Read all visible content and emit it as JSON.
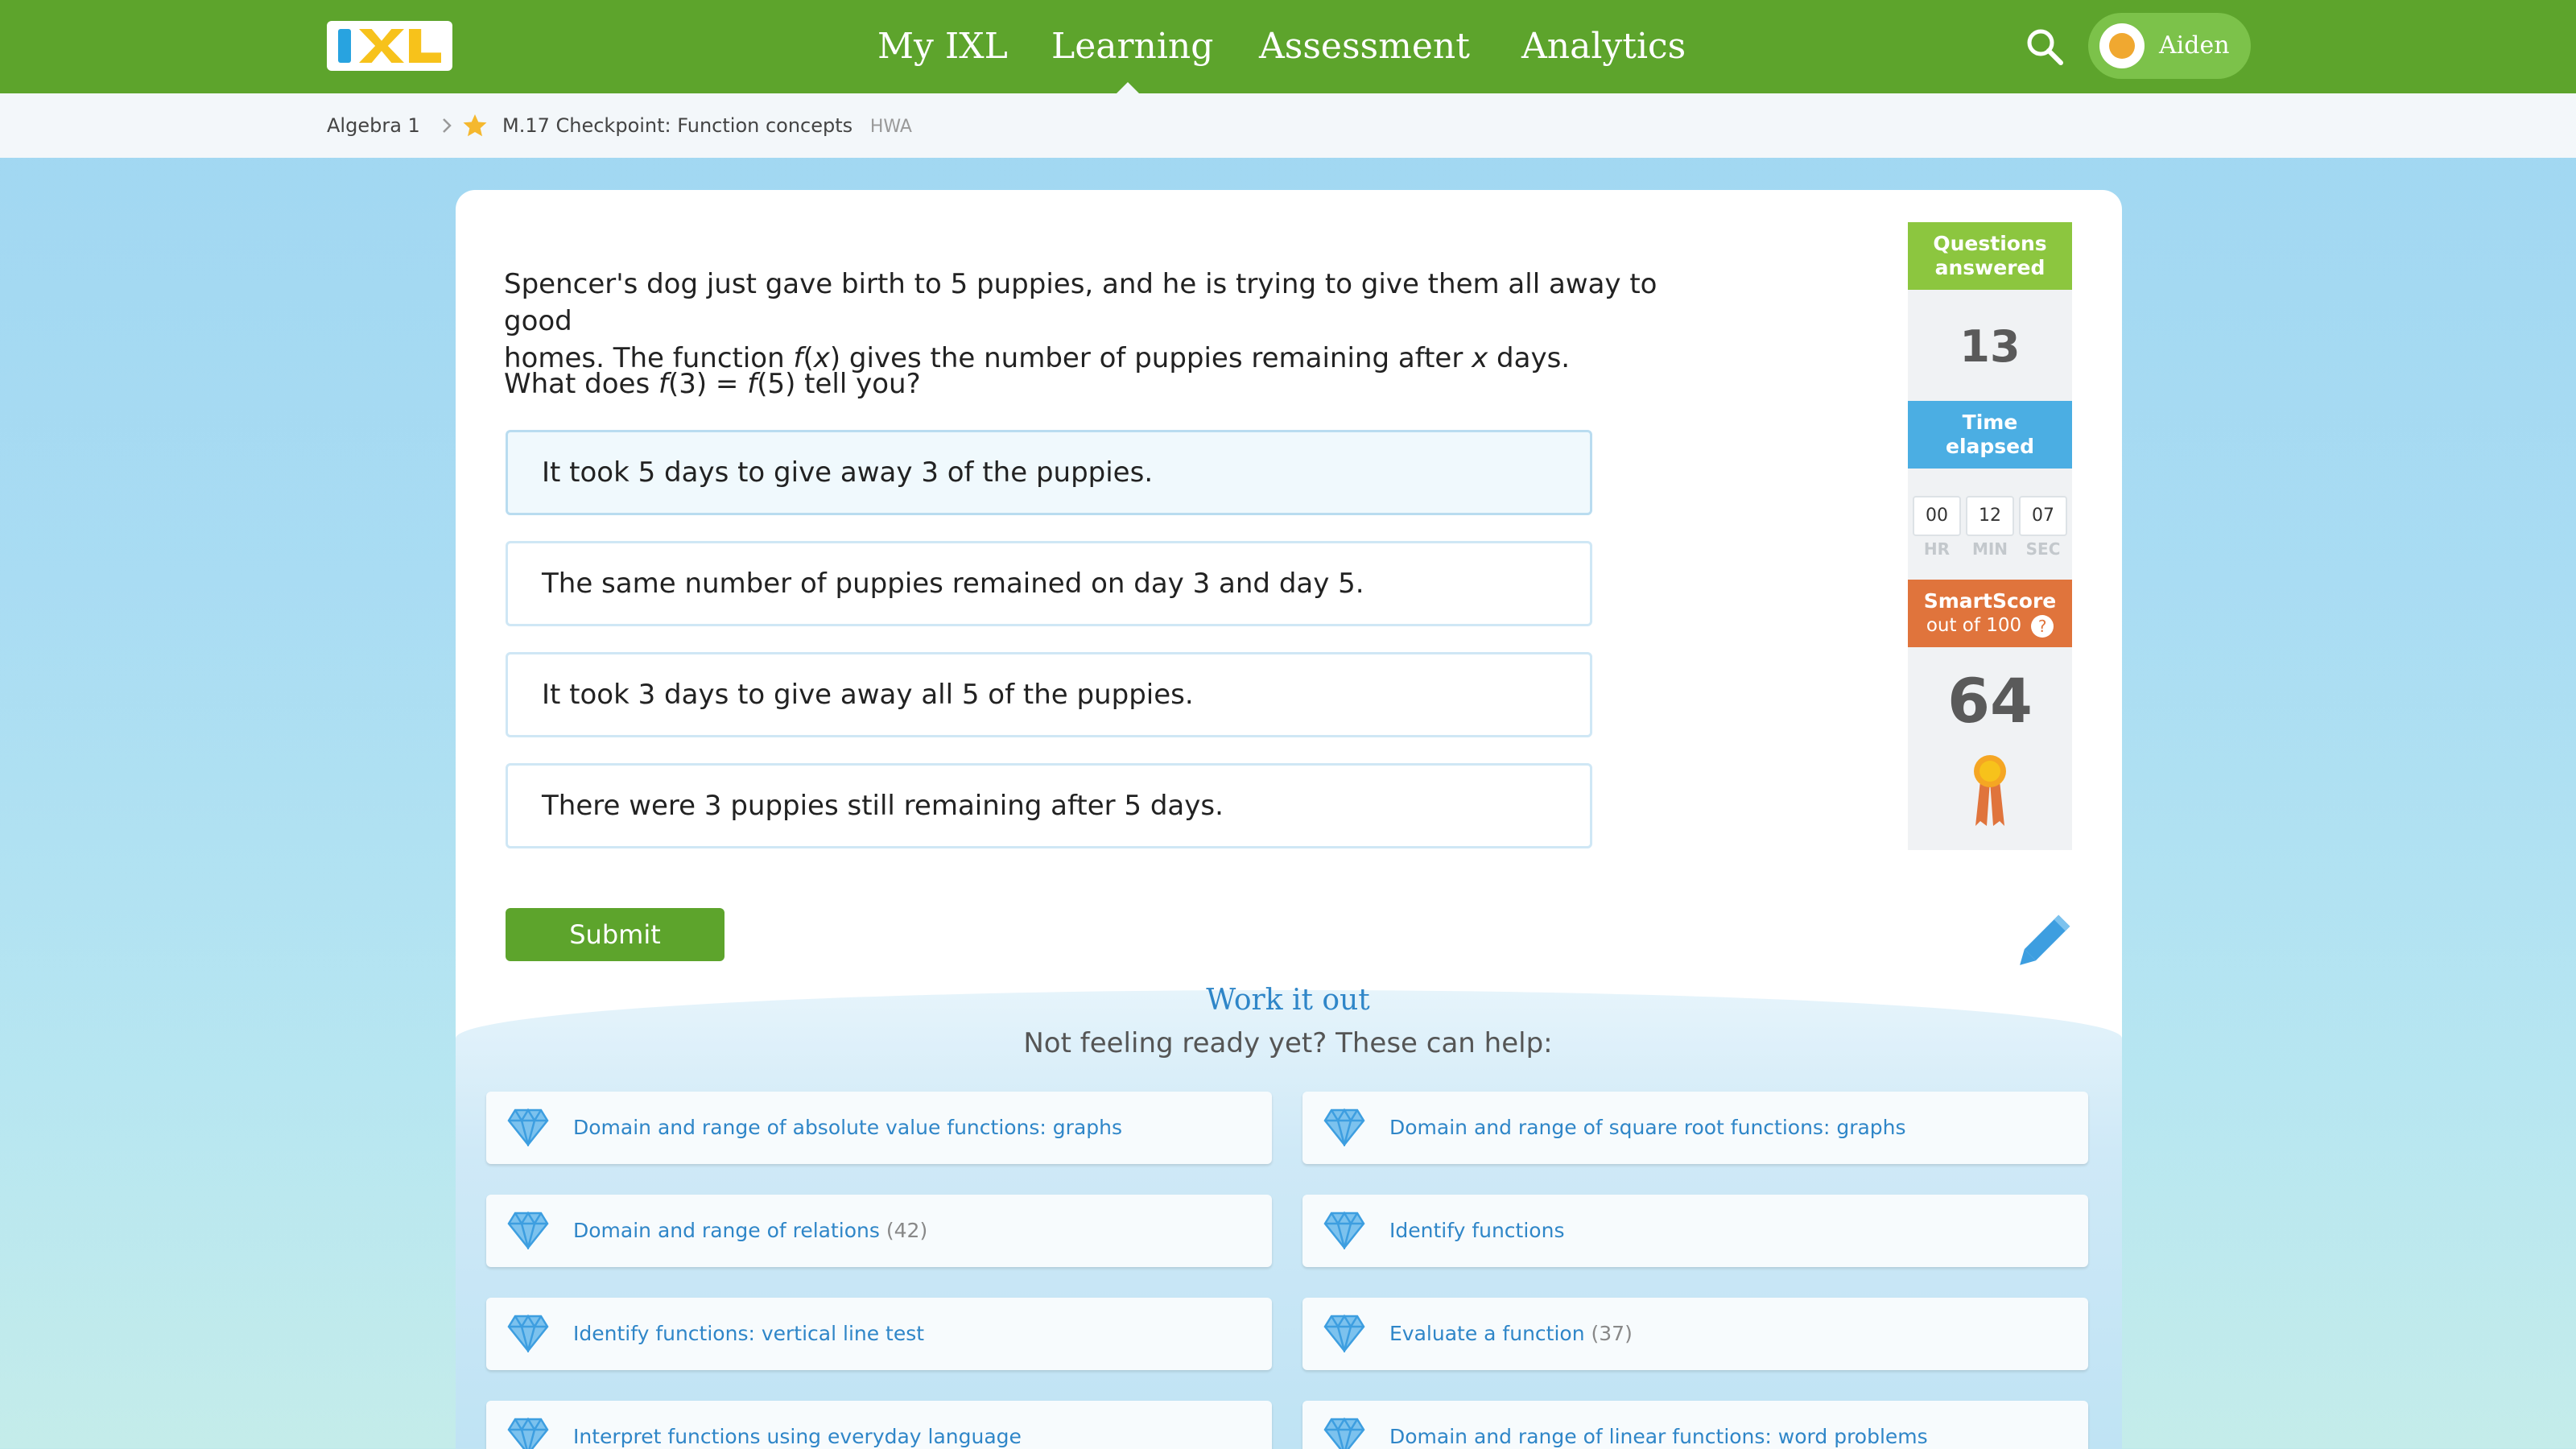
{
  "nav": {
    "links": [
      "My IXL",
      "Learning",
      "Assessment",
      "Analytics"
    ],
    "active": "Learning",
    "user_name": "Aiden"
  },
  "breadcrumb": {
    "subject": "Algebra 1",
    "skill": "M.17 Checkpoint: Function concepts",
    "tag": "HWA"
  },
  "question": {
    "line1": "Spencer's dog just gave birth to 5 puppies, and he is trying to give them all away to good",
    "line2_pre": "homes. The function ",
    "line2_f": "f",
    "line2_paren_open": "(",
    "line2_x": "x",
    "line2_paren_close": ")",
    "line2_mid": " gives the number of puppies remaining after ",
    "line2_x2": "x",
    "line2_post": " days.",
    "prompt_pre": "What does ",
    "prompt_f1": "f",
    "prompt_mid": "(3) = ",
    "prompt_f2": "f",
    "prompt_post": "(5) tell you?",
    "choices": [
      "It took 5 days to give away 3 of the puppies.",
      "The same number of puppies remained on day 3 and day 5.",
      "It took 3 days to give away all 5 of the puppies.",
      "There were 3 puppies still remaining after 5 days."
    ],
    "selected_index": 0,
    "submit_label": "Submit"
  },
  "stats": {
    "questions_label_1": "Questions",
    "questions_label_2": "answered",
    "questions_answered": "13",
    "time_label_1": "Time",
    "time_label_2": "elapsed",
    "time": {
      "hr": "00",
      "min": "12",
      "sec": "07"
    },
    "time_units": {
      "hr": "HR",
      "min": "MIN",
      "sec": "SEC"
    },
    "smartscore_label": "SmartScore",
    "smartscore_sub": "out of 100",
    "smartscore": "64",
    "colors": {
      "questions": "#8cc63f",
      "time": "#4baee3",
      "smartscore": "#e0743c"
    }
  },
  "work_it_out": {
    "title": "Work it out",
    "subtitle": "Not feeling ready yet? These can help:",
    "skills": [
      {
        "label": "Domain and range of absolute value functions: graphs",
        "count": ""
      },
      {
        "label": "Domain and range of square root functions: graphs",
        "count": ""
      },
      {
        "label": "Domain and range of relations",
        "count": "(42)"
      },
      {
        "label": "Identify functions",
        "count": ""
      },
      {
        "label": "Identify functions: vertical line test",
        "count": ""
      },
      {
        "label": "Evaluate a function",
        "count": "(37)"
      },
      {
        "label": "Interpret functions using everyday language",
        "count": ""
      },
      {
        "label": "Domain and range of linear functions: word problems",
        "count": ""
      }
    ]
  },
  "colors": {
    "nav_green": "#5da42c",
    "link_blue": "#2f86c8"
  }
}
